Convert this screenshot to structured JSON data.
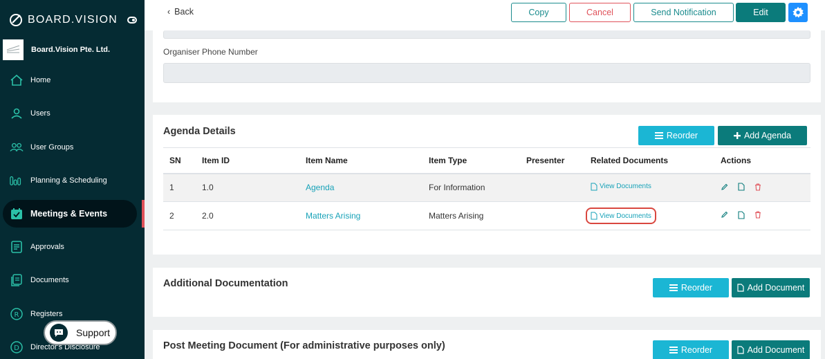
{
  "sidebar": {
    "brand": "BOARD.VISION",
    "org_name": "Board.Vision Pte. Ltd.",
    "items": [
      {
        "label": "Home",
        "icon": "home-icon"
      },
      {
        "label": "Users",
        "icon": "user-icon"
      },
      {
        "label": "User Groups",
        "icon": "user-group-icon"
      },
      {
        "label": "Planning & Scheduling",
        "icon": "bar-chart-icon"
      },
      {
        "label": "Meetings & Events",
        "icon": "calendar-check-icon",
        "active": true
      },
      {
        "label": "Approvals",
        "icon": "approvals-icon"
      },
      {
        "label": "Documents",
        "icon": "documents-icon"
      },
      {
        "label": "Registers",
        "icon": "registers-icon"
      },
      {
        "label": "Director's Disclosure",
        "icon": "disclosure-icon"
      }
    ],
    "support_label": "Support"
  },
  "topbar": {
    "back_label": "Back",
    "copy_label": "Copy",
    "cancel_label": "Cancel",
    "notify_label": "Send Notification",
    "edit_label": "Edit"
  },
  "organiser": {
    "phone_label": "Organiser Phone Number",
    "phone_value": ""
  },
  "agenda": {
    "title": "Agenda Details",
    "reorder_label": "Reorder",
    "add_label": "Add Agenda",
    "columns": [
      "SN",
      "Item ID",
      "Item Name",
      "Item Type",
      "Presenter",
      "Related Documents",
      "Actions"
    ],
    "rows": [
      {
        "sn": "1",
        "item_id": "1.0",
        "item_name": "Agenda",
        "item_type": "For Information",
        "presenter": "",
        "docs": "View Documents"
      },
      {
        "sn": "2",
        "item_id": "2.0",
        "item_name": "Matters Arising",
        "item_type": "Matters Arising",
        "presenter": "",
        "docs": "View Documents"
      }
    ]
  },
  "additional": {
    "title": "Additional Documentation",
    "reorder_label": "Reorder",
    "add_label": "Add Document"
  },
  "post_meeting": {
    "title": "Post Meeting Document (For administrative purposes only)",
    "reorder_label": "Reorder",
    "add_label": "Add Document"
  },
  "colors": {
    "sidebar_bg": "#052b33",
    "teal": "#0b7b7b",
    "cyan": "#1bb6d4",
    "danger": "#e0525a",
    "link": "#17a2b8"
  }
}
